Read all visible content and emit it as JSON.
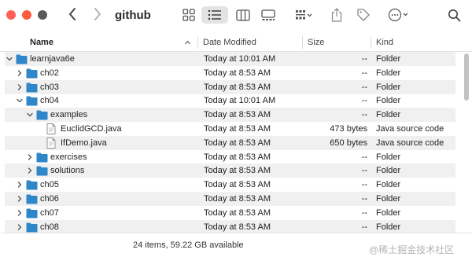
{
  "window": {
    "title": "github"
  },
  "colors": {
    "folder": "#2f86c8",
    "close": "#ff5f57",
    "minimize": "#fd5b3c",
    "zoom": "#5a5a5a",
    "row_alt": "#f0f0f0"
  },
  "toolbar": {
    "back_glyph": "‹",
    "forward_glyph": "›",
    "icons": [
      "icon-view-icon",
      "list-view-icon",
      "column-view-icon",
      "gallery-view-icon",
      "group-icon",
      "share-icon",
      "tag-icon",
      "more-icon",
      "search-icon"
    ],
    "selected_view": "list"
  },
  "columns": {
    "name": "Name",
    "date": "Date Modified",
    "size": "Size",
    "kind": "Kind",
    "sort_indicator": "^"
  },
  "rows": [
    {
      "name": "learnjava6e",
      "date": "Today at 10:01 AM",
      "size": "--",
      "kind": "Folder",
      "type": "folder",
      "depth": 0,
      "expanded": true
    },
    {
      "name": "ch02",
      "date": "Today at 8:53 AM",
      "size": "--",
      "kind": "Folder",
      "type": "folder",
      "depth": 1,
      "expanded": false
    },
    {
      "name": "ch03",
      "date": "Today at 8:53 AM",
      "size": "--",
      "kind": "Folder",
      "type": "folder",
      "depth": 1,
      "expanded": false
    },
    {
      "name": "ch04",
      "date": "Today at 10:01 AM",
      "size": "--",
      "kind": "Folder",
      "type": "folder",
      "depth": 1,
      "expanded": true
    },
    {
      "name": "examples",
      "date": "Today at 8:53 AM",
      "size": "--",
      "kind": "Folder",
      "type": "folder",
      "depth": 2,
      "expanded": true
    },
    {
      "name": "EuclidGCD.java",
      "date": "Today at 8:53 AM",
      "size": "473 bytes",
      "kind": "Java source code",
      "type": "file",
      "depth": 3,
      "expanded": false
    },
    {
      "name": "IfDemo.java",
      "date": "Today at 8:53 AM",
      "size": "650 bytes",
      "kind": "Java source code",
      "type": "file",
      "depth": 3,
      "expanded": false
    },
    {
      "name": "exercises",
      "date": "Today at 8:53 AM",
      "size": "--",
      "kind": "Folder",
      "type": "folder",
      "depth": 2,
      "expanded": false
    },
    {
      "name": "solutions",
      "date": "Today at 8:53 AM",
      "size": "--",
      "kind": "Folder",
      "type": "folder",
      "depth": 2,
      "expanded": false
    },
    {
      "name": "ch05",
      "date": "Today at 8:53 AM",
      "size": "--",
      "kind": "Folder",
      "type": "folder",
      "depth": 1,
      "expanded": false
    },
    {
      "name": "ch06",
      "date": "Today at 8:53 AM",
      "size": "--",
      "kind": "Folder",
      "type": "folder",
      "depth": 1,
      "expanded": false
    },
    {
      "name": "ch07",
      "date": "Today at 8:53 AM",
      "size": "--",
      "kind": "Folder",
      "type": "folder",
      "depth": 1,
      "expanded": false
    },
    {
      "name": "ch08",
      "date": "Today at 8:53 AM",
      "size": "--",
      "kind": "Folder",
      "type": "folder",
      "depth": 1,
      "expanded": false
    }
  ],
  "status": {
    "text": "24 items, 59.22 GB available"
  },
  "watermark": "@稀土掘金技术社区"
}
